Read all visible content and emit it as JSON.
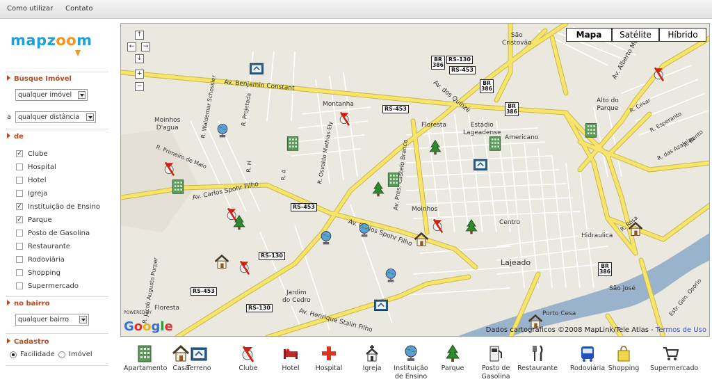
{
  "topbar": {
    "links": [
      "Como utilizar",
      "Contato"
    ]
  },
  "logo": {
    "text_pre": "mapz",
    "text_oo": "oo",
    "text_post": "m"
  },
  "search": {
    "section_title": "Busque Imóvel",
    "property_select": "qualquer imóvel",
    "distance_prefix": "a",
    "distance_select": "qualquer distância",
    "de_title": "de",
    "facilities": [
      {
        "label": "Clube",
        "checked": true
      },
      {
        "label": "Hospital",
        "checked": false
      },
      {
        "label": "Hotel",
        "checked": false
      },
      {
        "label": "Igreja",
        "checked": false
      },
      {
        "label": "Instituição de Ensino",
        "checked": true
      },
      {
        "label": "Parque",
        "checked": true
      },
      {
        "label": "Posto de Gasolina",
        "checked": false
      },
      {
        "label": "Restaurante",
        "checked": false
      },
      {
        "label": "Rodoviária",
        "checked": false
      },
      {
        "label": "Shopping",
        "checked": false
      },
      {
        "label": "Supermercado",
        "checked": false
      }
    ],
    "bairro_title": "no bairro",
    "bairro_select": "qualquer bairro",
    "cadastro_title": "Cadastro",
    "cadastro_options": [
      {
        "label": "Facilidade",
        "selected": true
      },
      {
        "label": "Imóvel",
        "selected": false
      }
    ]
  },
  "map": {
    "map_types": [
      "Mapa",
      "Satélite",
      "Híbrido"
    ],
    "selected_type": "Mapa",
    "nav_buttons": [
      "↑",
      "←",
      "→",
      "↓",
      "+",
      "−"
    ],
    "places": {
      "sao_cristovao": "São\nCristovão",
      "montanha": "Montanha",
      "moinhos_dagua": "Moinhos\nD'agua",
      "floresta_top": "Floresta",
      "estadio": "Estádio\nLageadense",
      "americano": "Americano",
      "alto_do_parque": "Alto do\nParque",
      "moinhos": "Moinhos",
      "centro": "Centro",
      "lajeado": "Lajeado",
      "hidraulica": "Hidraulica",
      "sao_jose": "São José",
      "jardim_do_cedro": "Jardim\ndo Cedro",
      "floresta_bottom": "Floresta",
      "porto_cesa": "Porto Cesa"
    },
    "streets": {
      "benjamin": "Av. Benjamin Constant",
      "quinze": "Av. dos Quinze",
      "carlos1": "Av. Carlos Spohr Filho",
      "carlos2": "Av. Carlos Spohr Filho",
      "henrique": "Av. Henrique Stalin Filho",
      "alberto": "Av. Alberto Muller",
      "primeiro": "R. Primeiro de Maio",
      "waldemar": "R. Waldemar Schossler",
      "osvaldo": "R. Osvaldo Mathias Ely",
      "projetada": "R. Projetada",
      "jacob": "R. Jacob Augusto Purper",
      "pres_castelo": "Av. Pres. Castelo Branco",
      "cesar": "R. Cesar",
      "esperanto": "R. Esperanto",
      "azaleias": "R. das Azaleias",
      "bento": "R. Bento",
      "rosa": "R. Rosa",
      "gen_osorio": "Estr. Gen. Osorio",
      "rh": "R. H",
      "ra": "R. A"
    },
    "shields": {
      "rs130_top": "RS-130",
      "rs453_top": "RS-453",
      "rs453_mid": "RS-453",
      "rs453_c": "RS-453",
      "rs130_mid": "RS-130",
      "rs453_bl": "RS-453",
      "rs130_b": "RS-130",
      "br386_1": "BR\n386",
      "br386_2": "BR\n386",
      "br386_3": "BR\n386",
      "br386_4": "BR\n386"
    },
    "attribution": "Dados cartográficos ©2008 MapLink/Tele Atlas - ",
    "terms_link": "Termos de Uso",
    "powered_by": "POWERED BY",
    "google": "Google"
  },
  "legend": [
    {
      "label": "Apartamento",
      "icon": "apartment-icon"
    },
    {
      "label": "Casa",
      "icon": "house-icon"
    },
    {
      "label": "Terreno",
      "icon": "land-icon"
    },
    {
      "label": "Clube",
      "icon": "club-icon"
    },
    {
      "label": "Hotel",
      "icon": "hotel-icon"
    },
    {
      "label": "Hospital",
      "icon": "hospital-icon"
    },
    {
      "label": "Igreja",
      "icon": "church-icon"
    },
    {
      "label": "Instituição\nde Ensino",
      "icon": "school-globe-icon"
    },
    {
      "label": "Parque",
      "icon": "park-tree-icon"
    },
    {
      "label": "Posto de\nGasolina",
      "icon": "gas-station-icon"
    },
    {
      "label": "Restaurante",
      "icon": "restaurant-icon"
    },
    {
      "label": "Rodoviária",
      "icon": "bus-icon"
    },
    {
      "label": "Shopping",
      "icon": "shopping-icon"
    },
    {
      "label": "Supermercado",
      "icon": "supermarket-cart-icon"
    }
  ],
  "colors": {
    "brand_blue": "#1ea0d8",
    "brand_orange": "#f29322",
    "section_red": "#c0471c",
    "road_yellow": "#f7e46b",
    "river_blue": "#99b3cc",
    "map_bg": "#ebe8e0"
  }
}
